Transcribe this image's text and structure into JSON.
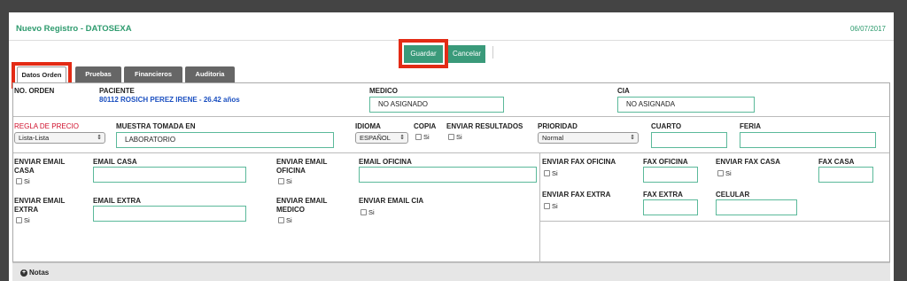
{
  "header": {
    "title": "Nuevo Registro - DATOSEXA",
    "date": "06/07/2017"
  },
  "toolbar": {
    "save_label": "Guardar",
    "cancel_label": "Cancelar"
  },
  "tabs": [
    {
      "label": "Datos Orden"
    },
    {
      "label": "Pruebas"
    },
    {
      "label": "Financieros"
    },
    {
      "label": "Auditoria"
    }
  ],
  "form": {
    "no_orden_label": "NO. ORDEN",
    "paciente_label": "PACIENTE",
    "paciente_value": "80112 ROSICH PEREZ IRENE - 26.42 años",
    "medico_label": "MEDICO",
    "medico_value": "NO ASIGNADO",
    "cia_label": "CIA",
    "cia_value": "NO ASIGNADA",
    "regla_label": "REGLA DE PRECIO",
    "regla_value": "Lista-Lista",
    "muestra_label": "MUESTRA TOMADA EN",
    "muestra_value": "LABORATORIO",
    "idioma_label": "IDIOMA",
    "idioma_value": "ESPAÑOL",
    "copia_label": "COPIA",
    "enviar_resultados_label": "ENVIAR RESULTADOS",
    "prioridad_label": "PRIORIDAD",
    "prioridad_value": "Normal",
    "cuarto_label": "CUARTO",
    "feria_label": "FERIA",
    "si_label": "Si",
    "enviar_email_casa_label_1": "ENVIAR EMAIL",
    "enviar_email_casa_label_2": "CASA",
    "email_casa_label": "EMAIL CASA",
    "enviar_email_oficina_label_1": "ENVIAR EMAIL",
    "enviar_email_oficina_label_2": "OFICINA",
    "email_oficina_label": "EMAIL OFICINA",
    "enviar_email_extra_label_1": "ENVIAR EMAIL",
    "enviar_email_extra_label_2": "EXTRA",
    "email_extra_label": "EMAIL EXTRA",
    "enviar_email_medico_label_1": "ENVIAR EMAIL",
    "enviar_email_medico_label_2": "MEDICO",
    "enviar_email_cia_label": "ENVIAR EMAIL CIA",
    "enviar_fax_oficina_label": "ENVIAR FAX OFICINA",
    "fax_oficina_label": "FAX OFICINA",
    "enviar_fax_casa_label": "ENVIAR FAX CASA",
    "fax_casa_label": "FAX CASA",
    "enviar_fax_extra_label": "ENVIAR FAX EXTRA",
    "fax_extra_label": "FAX EXTRA",
    "celular_label": "CELULAR"
  },
  "notes": {
    "label": "Notas"
  },
  "colors": {
    "accent": "#3a9a7a",
    "highlight": "#e32b15",
    "required": "#d0102c",
    "link": "#1a4fc0"
  }
}
